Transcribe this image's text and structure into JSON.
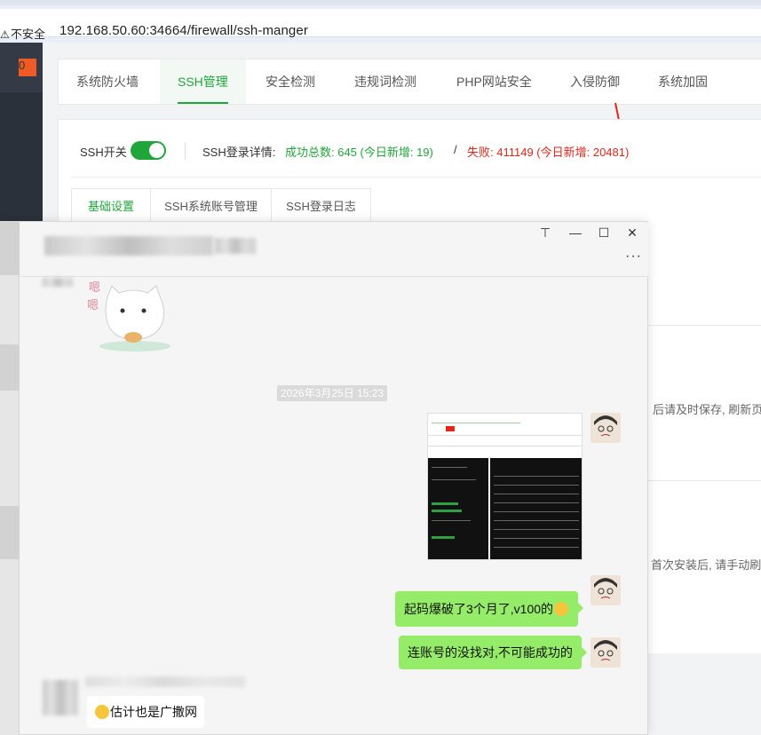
{
  "browser": {
    "security_label": "不安全",
    "url": "192.168.50.60:34664/firewall/ssh-manger"
  },
  "sidebar": {
    "badge": "0"
  },
  "tabs": [
    {
      "label": "系统防火墙",
      "active": false
    },
    {
      "label": "SSH管理",
      "active": true
    },
    {
      "label": "安全检测",
      "active": false
    },
    {
      "label": "违规词检测",
      "active": false
    },
    {
      "label": "PHP网站安全",
      "active": false
    },
    {
      "label": "入侵防御",
      "active": false
    },
    {
      "label": "系统加固",
      "active": false
    }
  ],
  "ssh": {
    "switch_label": "SSH开关",
    "switch_on": true,
    "detail_label": "SSH登录详情:",
    "success_text": "成功总数: 645 (今日新增: 19)",
    "separator": "/",
    "fail_text": "失败: 411149 (今日新增: 20481)"
  },
  "subtabs": [
    {
      "label": "基础设置",
      "active": true
    },
    {
      "label": "SSH系统账号管理",
      "active": false
    },
    {
      "label": "SSH登录日志",
      "active": false
    }
  ],
  "background_notes": {
    "note1": "后请及时保存, 刷新页面",
    "note2": "首次安装后, 请手动刷新页"
  },
  "chat": {
    "timestamp": "2026年3月25日 15:23",
    "messages": {
      "msg1": "起码爆破了3个月了,v100的",
      "msg2": "连账号的没找对,不可能成功的",
      "msg3": "估计也是广撒网"
    },
    "sticker_text": "嗯"
  },
  "colors": {
    "accent_green": "#20a53a",
    "fail_red": "#e0251b",
    "bubble_green": "#95ec69",
    "badge_orange": "#f05a24"
  }
}
